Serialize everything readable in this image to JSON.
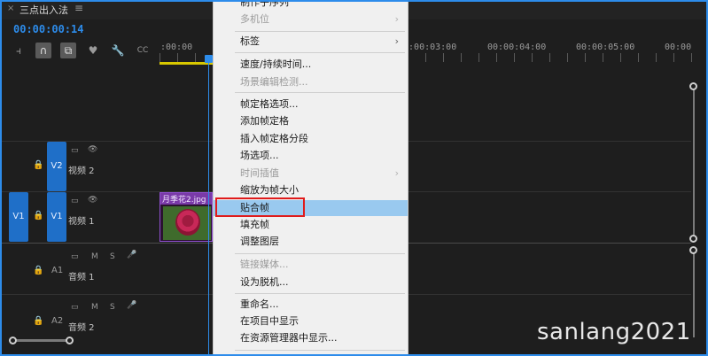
{
  "tab": {
    "close": "×",
    "title": "三点出入法",
    "menu": "≡"
  },
  "timecode": "00:00:00:14",
  "tools": [
    {
      "icon": "insert-edit-icon",
      "glyph": "⫞"
    },
    {
      "icon": "snap-magnet-icon",
      "glyph": "∩"
    },
    {
      "icon": "linked-selection-icon",
      "glyph": "⧉"
    },
    {
      "icon": "add-marker-icon",
      "glyph": "♥"
    },
    {
      "icon": "wrench-settings-icon",
      "glyph": "🔧"
    },
    {
      "icon": "captions-icon",
      "glyph": "CC"
    }
  ],
  "ruler": [
    ":00:00",
    "00:00:03:00",
    "00:00:04:00",
    "00:00:05:00",
    "00:00"
  ],
  "tracks": {
    "v2": {
      "target": "V2",
      "name": "视频 2",
      "lock": "🔒",
      "camera": "▭",
      "eye": "👁"
    },
    "v1": {
      "source": "V1",
      "target": "V1",
      "name": "视频 1",
      "lock": "🔒",
      "camera": "▭",
      "eye": "👁"
    },
    "a1": {
      "target": "A1",
      "name": "音频 1",
      "lock": "🔒",
      "camera": "▭",
      "mute": "M",
      "solo": "S",
      "mic": "🎤"
    },
    "a2": {
      "target": "A2",
      "name": "音频 2",
      "lock": "🔒",
      "camera": "▭",
      "mute": "M",
      "solo": "S",
      "mic": "🎤"
    }
  },
  "clip": {
    "title": "月季花2.jpg"
  },
  "menu": {
    "items": [
      {
        "label": "制作子序列",
        "disabled": false
      },
      {
        "label": "多机位",
        "disabled": true,
        "arrow": "›"
      },
      {
        "label": "标签",
        "disabled": false,
        "arrow": "›"
      },
      {
        "label": "速度/持续时间...",
        "disabled": false
      },
      {
        "label": "场景编辑检测...",
        "disabled": true
      },
      {
        "label": "帧定格选项...",
        "disabled": false
      },
      {
        "label": "添加帧定格",
        "disabled": false
      },
      {
        "label": "插入帧定格分段",
        "disabled": false
      },
      {
        "label": "场选项...",
        "disabled": false
      },
      {
        "label": "时间插值",
        "disabled": true,
        "arrow": "›"
      },
      {
        "label": "缩放为帧大小",
        "disabled": false
      },
      {
        "label": "贴合帧",
        "disabled": false,
        "highlighted": true
      },
      {
        "label": "填充帧",
        "disabled": false
      },
      {
        "label": "调整图层",
        "disabled": false
      },
      {
        "label": "链接媒体...",
        "disabled": true
      },
      {
        "label": "设为脱机...",
        "disabled": false
      },
      {
        "label": "重命名...",
        "disabled": false
      },
      {
        "label": "在项目中显示",
        "disabled": false
      },
      {
        "label": "在资源管理器中显示...",
        "disabled": false
      }
    ]
  },
  "watermark": "sanlang2021",
  "colors": {
    "accent": "#2d8ceb",
    "highlight": "#99c9ef",
    "annotation": "#e01b1b",
    "clip": "#7a3aa8"
  }
}
